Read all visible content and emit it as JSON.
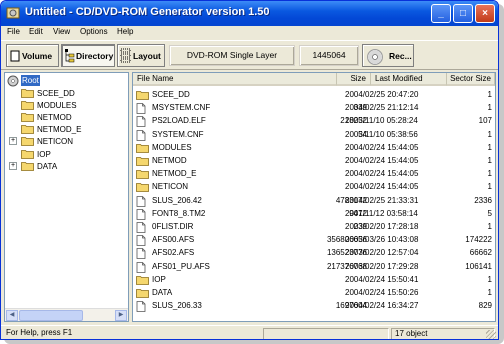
{
  "window": {
    "title": "Untitled - CD/DVD-ROM Generator version 1.50",
    "controls": {
      "minimize": "_",
      "maximize": "□",
      "close": "×"
    }
  },
  "menu": [
    "File",
    "Edit",
    "View",
    "Options",
    "Help"
  ],
  "toolbar": {
    "volume": "Volume",
    "directory": "Directory",
    "layout": "Layout",
    "media_type": "DVD-ROM Single Layer",
    "size": "1445064",
    "record": "Rec..."
  },
  "tree": {
    "root": "Root",
    "items": [
      {
        "label": "SCEE_DD",
        "expandable": false
      },
      {
        "label": "MODULES",
        "expandable": false
      },
      {
        "label": "NETMOD",
        "expandable": false
      },
      {
        "label": "NETMOD_E",
        "expandable": false
      },
      {
        "label": "NETICON",
        "expandable": true
      },
      {
        "label": "IOP",
        "expandable": false
      },
      {
        "label": "DATA",
        "expandable": true
      }
    ]
  },
  "list": {
    "columns": [
      "File Name",
      "Size",
      "Last Modified",
      "Sector Size"
    ],
    "rows": [
      {
        "name": "SCEE_DD",
        "type": "folder",
        "size": "",
        "modified": "2004/02/25 20:47:20",
        "sector": "1"
      },
      {
        "name": "MSYSTEM.CNF",
        "type": "file",
        "size": "339",
        "modified": "2004/02/25 21:12:14",
        "sector": "1"
      },
      {
        "name": "PS2LOAD.ELF",
        "type": "file",
        "size": "218252",
        "modified": "2003/11/10 05:28:24",
        "sector": "107"
      },
      {
        "name": "SYSTEM.CNF",
        "type": "file",
        "size": "54",
        "modified": "2003/11/10 05:38:56",
        "sector": "1"
      },
      {
        "name": "MODULES",
        "type": "folder",
        "size": "",
        "modified": "2004/02/24 15:44:05",
        "sector": "1"
      },
      {
        "name": "NETMOD",
        "type": "folder",
        "size": "",
        "modified": "2004/02/24 15:44:05",
        "sector": "1"
      },
      {
        "name": "NETMOD_E",
        "type": "folder",
        "size": "",
        "modified": "2004/02/24 15:44:05",
        "sector": "1"
      },
      {
        "name": "NETICON",
        "type": "folder",
        "size": "",
        "modified": "2004/02/24 15:44:05",
        "sector": "1"
      },
      {
        "name": "SLUS_206.42",
        "type": "file",
        "size": "4783172",
        "modified": "2004/02/25 21:33:31",
        "sector": "2336"
      },
      {
        "name": "FONT8_8.TM2",
        "type": "file",
        "size": "9472",
        "modified": "2001/11/12 03:58:14",
        "sector": "5"
      },
      {
        "name": "0FLIST.DIR",
        "type": "file",
        "size": "239",
        "modified": "2003/02/20 17:28:18",
        "sector": "1"
      },
      {
        "name": "AFS00.AFS",
        "type": "file",
        "size": "356806656",
        "modified": "2003/03/26 10:43:08",
        "sector": "174222"
      },
      {
        "name": "AFS02.AFS",
        "type": "file",
        "size": "136523776",
        "modified": "2003/02/20 12:57:04",
        "sector": "66662"
      },
      {
        "name": "AFS01_PU.AFS",
        "type": "file",
        "size": "217376768",
        "modified": "2003/02/20 17:29:28",
        "sector": "106141"
      },
      {
        "name": "IOP",
        "type": "folder",
        "size": "",
        "modified": "2004/02/24 15:50:41",
        "sector": "1"
      },
      {
        "name": "DATA",
        "type": "folder",
        "size": "",
        "modified": "2004/02/24 15:50:26",
        "sector": "1"
      },
      {
        "name": "SLUS_206.33",
        "type": "file",
        "size": "1697604",
        "modified": "2004/02/24 16:34:27",
        "sector": "829"
      }
    ]
  },
  "status": {
    "help": "For Help, press F1",
    "count": "17 object"
  }
}
